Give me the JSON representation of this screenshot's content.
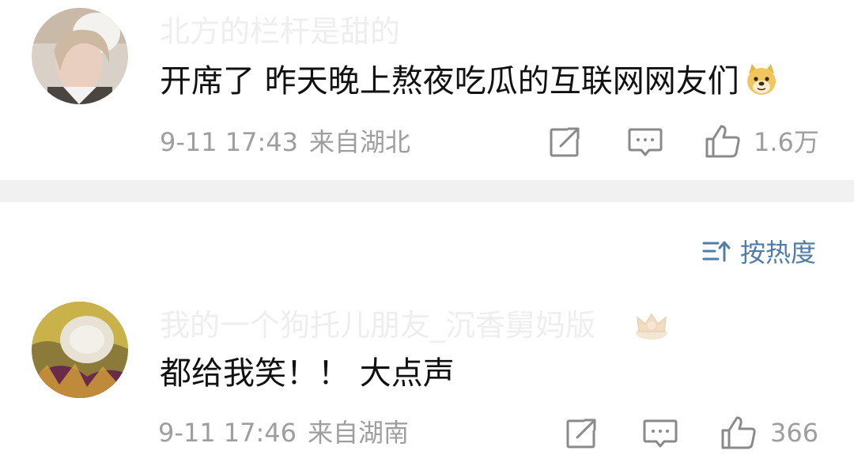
{
  "comments": [
    {
      "username": "北方的栏杆是甜的",
      "text": "开席了 昨天晚上熬夜吃瓜的互联网网友们",
      "emoji": "doge-emoji",
      "time": "9-11 17:43",
      "location": "来自湖北",
      "likes": "1.6万"
    },
    {
      "username": "我的一个狗托儿朋友_沉香舅妈版",
      "badge": "crown-icon",
      "text": "都给我笑！！ 大点声",
      "time": "9-11 17:46",
      "location": "来自湖南",
      "likes": "366"
    }
  ],
  "sort": {
    "label": "按热度",
    "icon": "sort-icon"
  },
  "colors": {
    "text": "#111111",
    "meta": "#9e9e9e",
    "username": "#eeeeee",
    "link_blue": "#4f7ca8",
    "divider": "#f1f1f1"
  }
}
